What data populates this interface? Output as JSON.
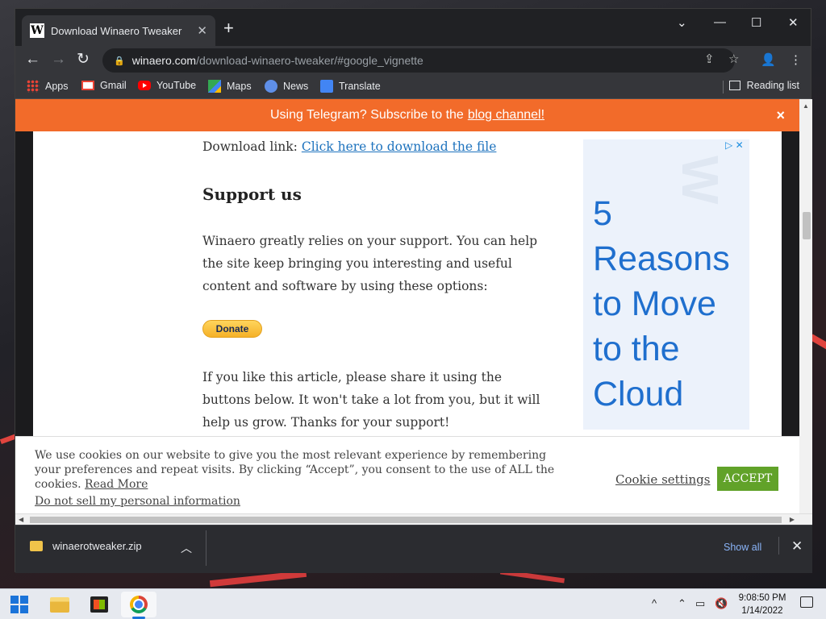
{
  "browser": {
    "tab_title": "Download Winaero Tweaker",
    "tab_favicon": "W",
    "url_host": "winaero.com",
    "url_path": "/download-winaero-tweaker/#google_vignette",
    "bookmarks": [
      "Apps",
      "Gmail",
      "YouTube",
      "Maps",
      "News",
      "Translate"
    ],
    "reading_list": "Reading list"
  },
  "banner": {
    "text": "Using Telegram? Subscribe to the",
    "link": "blog channel!",
    "close": "×",
    "color": "#f26b2a"
  },
  "article": {
    "download_label": "Download link: ",
    "download_link": "Click here to download the file",
    "heading": "Support us",
    "para1": "Winaero greatly relies on your support. You can help the site keep bringing you interesting and useful content and software by using these options:",
    "donate": "Donate",
    "para2": "If you like this article, please share it using the buttons below. It won't take a lot from you, but it will help us grow. Thanks for your support!"
  },
  "ad": {
    "headline": "5 Reasons to Move to the Cloud"
  },
  "cookie": {
    "text": "We use cookies on our website to give you the most relevant experience by remembering your preferences and repeat visits. By clicking “Accept”, you consent to the use of ALL the cookies.",
    "read_more": "Read More",
    "do_not_sell": "Do not sell my personal information",
    "settings": "Cookie settings",
    "accept": "ACCEPT",
    "accept_color": "#61a229"
  },
  "downloads": {
    "file": "winaerotweaker.zip",
    "show_all": "Show all"
  },
  "taskbar": {
    "time": "9:08:50 PM",
    "date": "1/14/2022"
  }
}
